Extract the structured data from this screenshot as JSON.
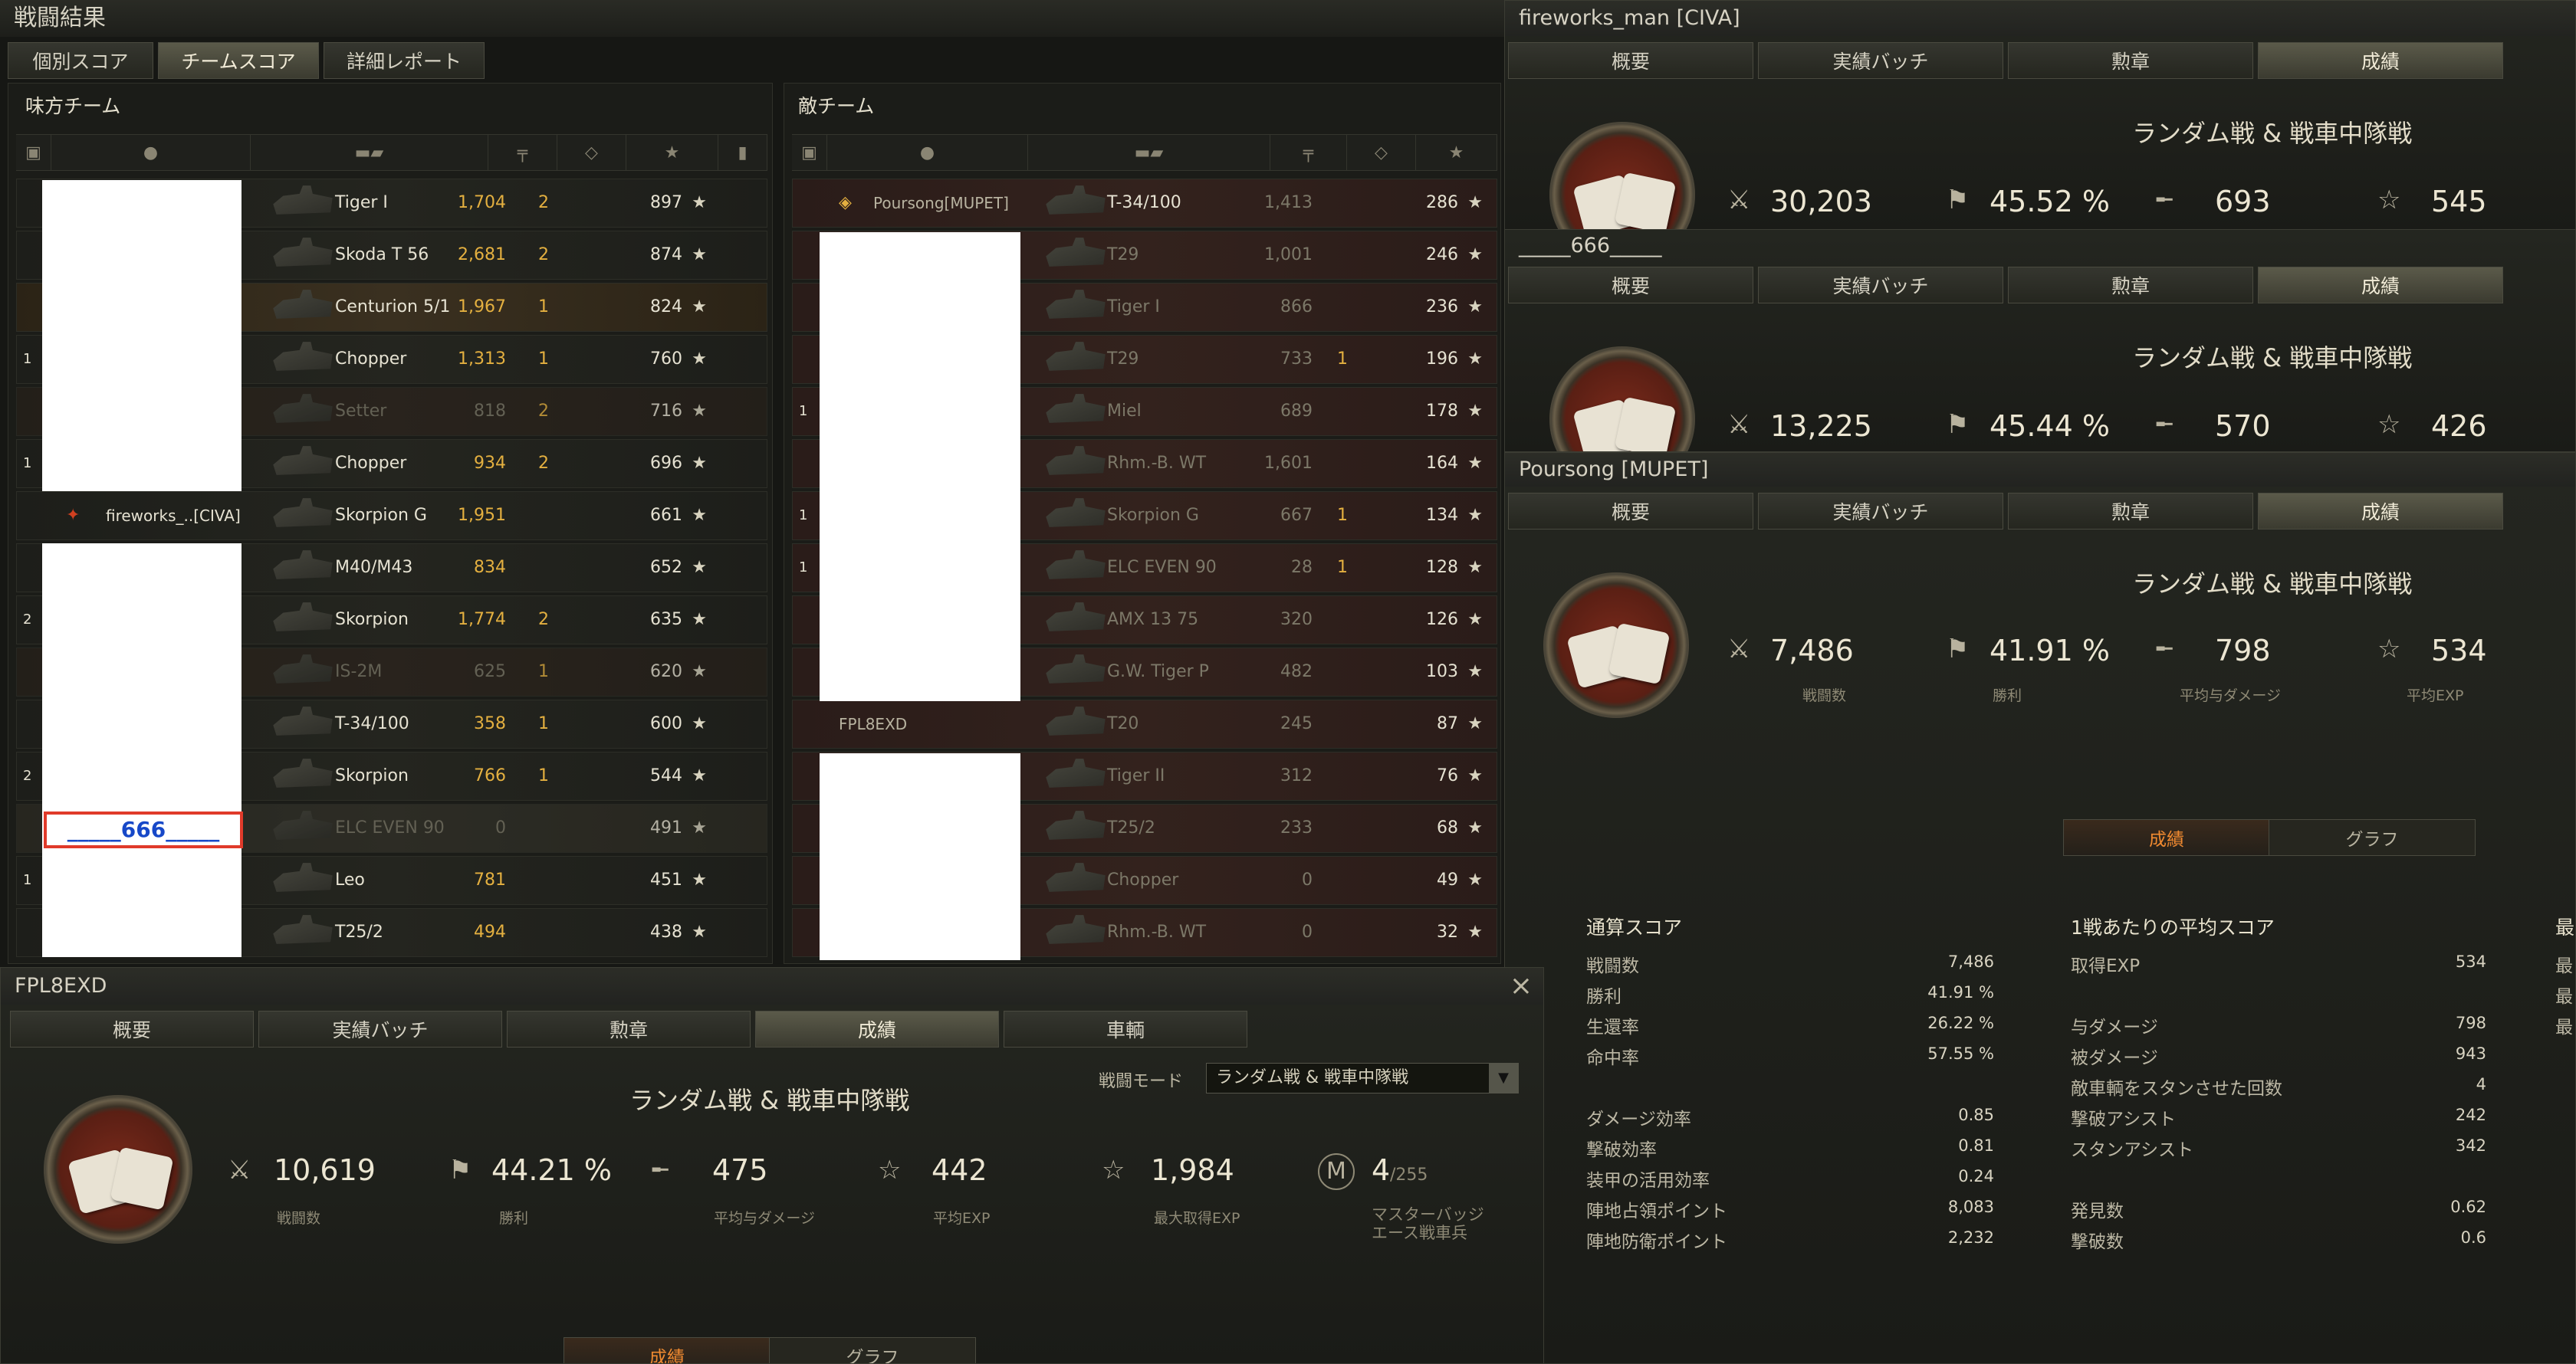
{
  "window": {
    "title": "戦闘結果",
    "tabs": [
      "個別スコア",
      "チームスコア",
      "詳細レポート"
    ],
    "close": "×"
  },
  "ally": {
    "title": "味方チーム",
    "highlight_name": "_____666_____",
    "named_player": "fireworks_..[CIVA]",
    "rows": [
      {
        "tank": "Tiger I",
        "dmg": "1,704",
        "kills": "2",
        "exp": "897"
      },
      {
        "tank": "Skoda T 56",
        "dmg": "2,681",
        "kills": "2",
        "exp": "874"
      },
      {
        "tank": "Centurion 5/1",
        "dmg": "1,967",
        "kills": "1",
        "exp": "824"
      },
      {
        "tank": "Chopper",
        "dmg": "1,313",
        "kills": "1",
        "exp": "760"
      },
      {
        "tank": "Setter",
        "dmg": "818",
        "kills": "2",
        "exp": "716"
      },
      {
        "tank": "Chopper",
        "dmg": "934",
        "kills": "2",
        "exp": "696"
      },
      {
        "tank": "Skorpion G",
        "dmg": "1,951",
        "kills": "",
        "exp": "661"
      },
      {
        "tank": "M40/M43",
        "dmg": "834",
        "kills": "",
        "exp": "652"
      },
      {
        "tank": "Skorpion",
        "dmg": "1,774",
        "kills": "2",
        "exp": "635"
      },
      {
        "tank": "IS-2M",
        "dmg": "625",
        "kills": "1",
        "exp": "620"
      },
      {
        "tank": "T-34/100",
        "dmg": "358",
        "kills": "1",
        "exp": "600"
      },
      {
        "tank": "Skorpion",
        "dmg": "766",
        "kills": "1",
        "exp": "544"
      },
      {
        "tank": "ELC EVEN 90",
        "dmg": "0",
        "kills": "",
        "exp": "491"
      },
      {
        "tank": "Leo",
        "dmg": "781",
        "kills": "",
        "exp": "451"
      },
      {
        "tank": "T25/2",
        "dmg": "494",
        "kills": "",
        "exp": "438"
      }
    ],
    "badges": [
      "1",
      "1",
      "2",
      "2",
      "1"
    ]
  },
  "enemy": {
    "title": "敵チーム",
    "player1": "Poursong[MUPET]",
    "player11": "FPL8EXD",
    "rows": [
      {
        "tank": "T-34/100",
        "dmg": "1,413",
        "kills": "",
        "exp": "286"
      },
      {
        "tank": "T29",
        "dmg": "1,001",
        "kills": "",
        "exp": "246"
      },
      {
        "tank": "Tiger I",
        "dmg": "866",
        "kills": "",
        "exp": "236"
      },
      {
        "tank": "T29",
        "dmg": "733",
        "kills": "1",
        "exp": "196"
      },
      {
        "tank": "Miel",
        "dmg": "689",
        "kills": "",
        "exp": "178"
      },
      {
        "tank": "Rhm.-B. WT",
        "dmg": "1,601",
        "kills": "",
        "exp": "164"
      },
      {
        "tank": "Skorpion G",
        "dmg": "667",
        "kills": "1",
        "exp": "134"
      },
      {
        "tank": "ELC EVEN 90",
        "dmg": "28",
        "kills": "1",
        "exp": "128"
      },
      {
        "tank": "AMX 13 75",
        "dmg": "320",
        "kills": "",
        "exp": "126"
      },
      {
        "tank": "G.W. Tiger P",
        "dmg": "482",
        "kills": "",
        "exp": "103"
      },
      {
        "tank": "T20",
        "dmg": "245",
        "kills": "",
        "exp": "87"
      },
      {
        "tank": "Tiger II",
        "dmg": "312",
        "kills": "",
        "exp": "76"
      },
      {
        "tank": "T25/2",
        "dmg": "233",
        "kills": "",
        "exp": "68"
      },
      {
        "tank": "Chopper",
        "dmg": "0",
        "kills": "",
        "exp": "49"
      },
      {
        "tank": "Rhm.-B. WT",
        "dmg": "0",
        "kills": "",
        "exp": "32"
      }
    ],
    "badges": [
      "1",
      "1",
      "1"
    ]
  },
  "profile_tabs": [
    "概要",
    "実績バッチ",
    "勲章",
    "成績",
    "車輌"
  ],
  "profiles": [
    {
      "name": "fireworks_man [CIVA]",
      "mode": "ランダム戦 & 戦車中隊戦",
      "battles": "30,203",
      "wins": "45.52 %",
      "avg_dmg": "693",
      "avg_exp": "545"
    },
    {
      "name": "_____666_____",
      "mode": "ランダム戦 & 戦車中隊戦",
      "battles": "13,225",
      "wins": "45.44 %",
      "avg_dmg": "570",
      "avg_exp": "426"
    },
    {
      "name": "Poursong [MUPET]",
      "mode": "ランダム戦 & 戦車中隊戦",
      "battles": "7,486",
      "wins": "41.91 %",
      "avg_dmg": "798",
      "avg_exp": "534",
      "labels": {
        "battles": "戦闘数",
        "wins": "勝利",
        "avg_dmg": "平均与ダメージ",
        "avg_exp": "平均EXP"
      }
    }
  ],
  "poursong_detail": {
    "subtabs": [
      "成績",
      "グラフ"
    ],
    "col1_title": "通算スコア",
    "col1": [
      {
        "k": "戦闘数",
        "v": "7,486"
      },
      {
        "k": "勝利",
        "v": "41.91 %"
      },
      {
        "k": "生還率",
        "v": "26.22 %"
      },
      {
        "k": "命中率",
        "v": "57.55 %"
      },
      {
        "k": "",
        "v": ""
      },
      {
        "k": "ダメージ効率",
        "v": "0.85"
      },
      {
        "k": "撃破効率",
        "v": "0.81"
      },
      {
        "k": "装甲の活用効率",
        "v": "0.24"
      },
      {
        "k": "陣地占領ポイント",
        "v": "8,083"
      },
      {
        "k": "陣地防衛ポイント",
        "v": "2,232"
      }
    ],
    "col2_title": "1戦あたりの平均スコア",
    "col2": [
      {
        "k": "取得EXP",
        "v": "534"
      },
      {
        "k": "",
        "v": ""
      },
      {
        "k": "与ダメージ",
        "v": "798"
      },
      {
        "k": "被ダメージ",
        "v": "943"
      },
      {
        "k": "敵車輌をスタンさせた回数",
        "v": "4"
      },
      {
        "k": "撃破アシスト",
        "v": "242"
      },
      {
        "k": "スタンアシスト",
        "v": "342"
      },
      {
        "k": "",
        "v": ""
      },
      {
        "k": "発見数",
        "v": "0.62"
      },
      {
        "k": "撃破数",
        "v": "0.6"
      }
    ],
    "col3_title": "最",
    "col3": [
      "最",
      "最",
      "最"
    ]
  },
  "fpl": {
    "name": "FPL8EXD",
    "mode": "ランダム戦 & 戦車中隊戦",
    "mode_label": "戦闘モード",
    "mode_select": "ランダム戦 & 戦車中隊戦",
    "battles": "10,619",
    "wins": "44.21 %",
    "avg_dmg": "475",
    "avg_exp": "442",
    "max_exp": "1,984",
    "master": "4",
    "master_total": "/255",
    "labels": {
      "battles": "戦闘数",
      "wins": "勝利",
      "avg_dmg": "平均与ダメージ",
      "avg_exp": "平均EXP",
      "max_exp": "最大取得EXP",
      "master": "マスターバッジ",
      "master2": "エース戦車兵"
    },
    "subtabs": [
      "成績",
      "グラフ"
    ]
  }
}
